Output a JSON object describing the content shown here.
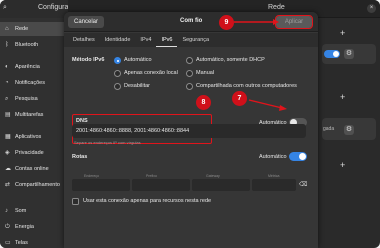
{
  "background_window": {
    "sidebar_title": "Configurações",
    "main_title": "Rede",
    "sidebar_items": [
      {
        "label": "Rede",
        "icon": "network-icon",
        "active": true
      },
      {
        "label": "Bluetooth",
        "icon": "bluetooth-icon"
      },
      {
        "label": "Aparência",
        "icon": "appearance-icon"
      },
      {
        "label": "Notificações",
        "icon": "bell-icon"
      },
      {
        "label": "Pesquisa",
        "icon": "search-icon"
      },
      {
        "label": "Multitarefas",
        "icon": "multitask-icon"
      },
      {
        "label": "Aplicativos",
        "icon": "apps-icon"
      },
      {
        "label": "Privacidade",
        "icon": "privacy-icon"
      },
      {
        "label": "Contas online",
        "icon": "cloud-icon"
      },
      {
        "label": "Compartilhamento",
        "icon": "share-icon"
      },
      {
        "label": "Som",
        "icon": "sound-icon"
      },
      {
        "label": "Energia",
        "icon": "power-icon"
      },
      {
        "label": "Telas",
        "icon": "display-icon"
      }
    ],
    "partial_text": "gada"
  },
  "dialog": {
    "cancel_label": "Cancelar",
    "title": "Com fio",
    "apply_label": "Aplicar",
    "tabs": [
      "Detalhes",
      "Identidade",
      "IPv4",
      "IPv6",
      "Segurança"
    ],
    "active_tab": "IPv6",
    "method_label": "Método IPv6",
    "methods": [
      "Automático",
      "Automático, somente DHCP",
      "Apenas conexão local",
      "Manual",
      "Desabilitar",
      "Compartilhada com outros computadores"
    ],
    "selected_method": "Automático",
    "dns_label": "DNS",
    "dns_auto_label": "Automático",
    "dns_auto_on": false,
    "dns_value": "2001:4860:4860::8888, 2001:4860:4860::8844",
    "dns_hint": "Separe os endereços IP com vírgulas",
    "routes_label": "Rotas",
    "routes_auto_label": "Automático",
    "routes_auto_on": true,
    "route_columns": [
      "Endereço",
      "Prefixo",
      "Gateway",
      "Métrica"
    ],
    "only_local_label": "Usar esta conexão apenas para recursos nesta rede"
  },
  "annotations": {
    "badge_apply": "9",
    "badge_dns": "8",
    "badge_toggle": "7",
    "color": "#d0101a"
  },
  "colors": {
    "accent": "#3584e4",
    "highlight": "#e0141b",
    "dialog_bg": "#363636"
  }
}
